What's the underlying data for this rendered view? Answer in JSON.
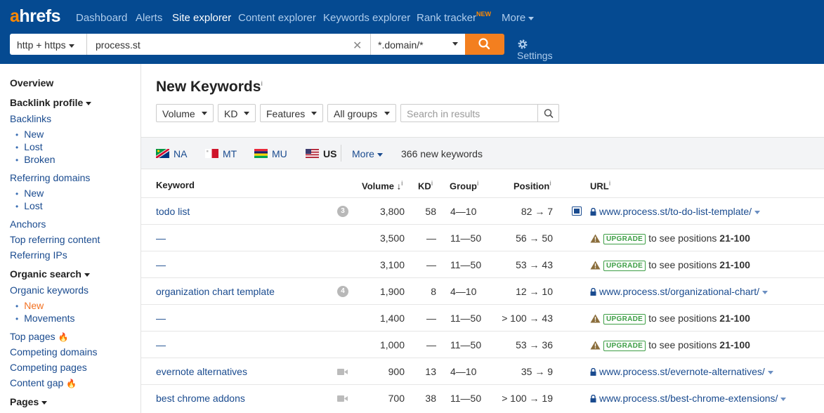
{
  "brand": {
    "logo_accent": "a",
    "logo_rest": "hrefs"
  },
  "nav": {
    "items": [
      "Dashboard",
      "Alerts",
      "Site explorer",
      "Content explorer",
      "Keywords explorer",
      "Rank tracker",
      "More"
    ],
    "new_badge": "NEW",
    "active": "Site explorer"
  },
  "search": {
    "protocol": "http + https",
    "target": "process.st",
    "mode": "*.domain/*",
    "settings_label": "Settings"
  },
  "sidebar": {
    "overview": "Overview",
    "backlink_profile": "Backlink profile",
    "backlinks": "Backlinks",
    "backlinks_sub": [
      "New",
      "Lost",
      "Broken"
    ],
    "referring_domains": "Referring domains",
    "referring_domains_sub": [
      "New",
      "Lost"
    ],
    "anchors": "Anchors",
    "top_referring_content": "Top referring content",
    "referring_ips": "Referring IPs",
    "organic_search": "Organic search",
    "organic_keywords": "Organic keywords",
    "organic_keywords_sub": [
      "New",
      "Movements"
    ],
    "top_pages": "Top pages",
    "competing_domains": "Competing domains",
    "competing_pages": "Competing pages",
    "content_gap": "Content gap",
    "pages": "Pages"
  },
  "page": {
    "title": "New Keywords",
    "info_mark": "i",
    "filters": [
      "Volume",
      "KD",
      "Features",
      "All groups"
    ],
    "search_placeholder": "Search in results"
  },
  "countries": {
    "items": [
      {
        "code": "NA"
      },
      {
        "code": "MT"
      },
      {
        "code": "MU"
      },
      {
        "code": "US"
      }
    ],
    "more_label": "More",
    "count_text": "366 new keywords"
  },
  "table": {
    "headers": {
      "keyword": "Keyword",
      "volume": "Volume",
      "kd": "KD",
      "group": "Group",
      "position": "Position",
      "url": "URL"
    },
    "upgrade_badge": "UPGRADE",
    "upgrade_text": "to see positions",
    "upgrade_range": "21-100",
    "rows": [
      {
        "keyword": "todo list",
        "badge": "3",
        "volume": "3,800",
        "kd": "58",
        "group": "4—10",
        "position": "82  →  7",
        "url": "www.process.st/to-do-list-template/"
      },
      {
        "keyword": "—",
        "volume": "3,500",
        "kd": "—",
        "group": "11—50",
        "position": "56  →  50"
      },
      {
        "keyword": "—",
        "volume": "3,100",
        "kd": "—",
        "group": "11—50",
        "position": "53  →  43"
      },
      {
        "keyword": "organization chart template",
        "badge": "4",
        "volume": "1,900",
        "kd": "8",
        "group": "4—10",
        "position": "12  →  10",
        "url": "www.process.st/organizational-chart/"
      },
      {
        "keyword": "—",
        "volume": "1,400",
        "kd": "—",
        "group": "11—50",
        "position": "> 100  →  43"
      },
      {
        "keyword": "—",
        "volume": "1,000",
        "kd": "—",
        "group": "11—50",
        "position": "53  →  36"
      },
      {
        "keyword": "evernote alternatives",
        "volume": "900",
        "kd": "13",
        "group": "4—10",
        "position": "35  →  9",
        "url": "www.process.st/evernote-alternatives/"
      },
      {
        "keyword": "best chrome addons",
        "volume": "700",
        "kd": "38",
        "group": "11—50",
        "position": "> 100  →  19",
        "url": "www.process.st/best-chrome-extensions/"
      }
    ]
  }
}
